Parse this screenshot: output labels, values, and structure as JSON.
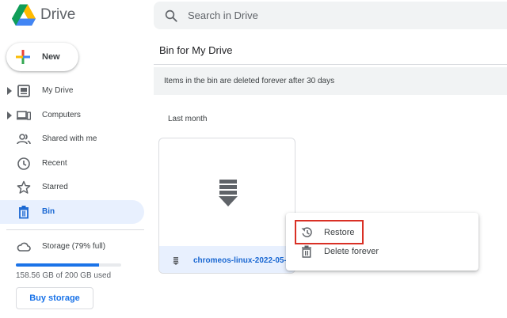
{
  "header": {
    "app_title": "Drive",
    "search_placeholder": "Search in Drive"
  },
  "sidebar": {
    "new_label": "New",
    "items": [
      {
        "label": "My Drive",
        "icon": "my-drive-icon",
        "expandable": true,
        "active": false
      },
      {
        "label": "Computers",
        "icon": "computers-icon",
        "expandable": true,
        "active": false
      },
      {
        "label": "Shared with me",
        "icon": "shared-icon",
        "expandable": false,
        "active": false
      },
      {
        "label": "Recent",
        "icon": "clock-icon",
        "expandable": false,
        "active": false
      },
      {
        "label": "Starred",
        "icon": "star-icon",
        "expandable": false,
        "active": false
      },
      {
        "label": "Bin",
        "icon": "trash-icon",
        "expandable": false,
        "active": true
      }
    ],
    "storage": {
      "label": "Storage (79% full)",
      "used_text": "158.56 GB of 200 GB used",
      "percent": 79,
      "buy_label": "Buy storage"
    }
  },
  "main": {
    "title": "Bin for My Drive",
    "notice": "Items in the bin are deleted forever after 30 days",
    "section_label": "Last month",
    "file": {
      "name": "chromeos-linux-2022-05-..."
    }
  },
  "context_menu": {
    "restore": "Restore",
    "delete_forever": "Delete forever"
  },
  "colors": {
    "accent": "#1a73e8",
    "active_bg": "#e8f0fe",
    "highlight": "#d93025"
  }
}
